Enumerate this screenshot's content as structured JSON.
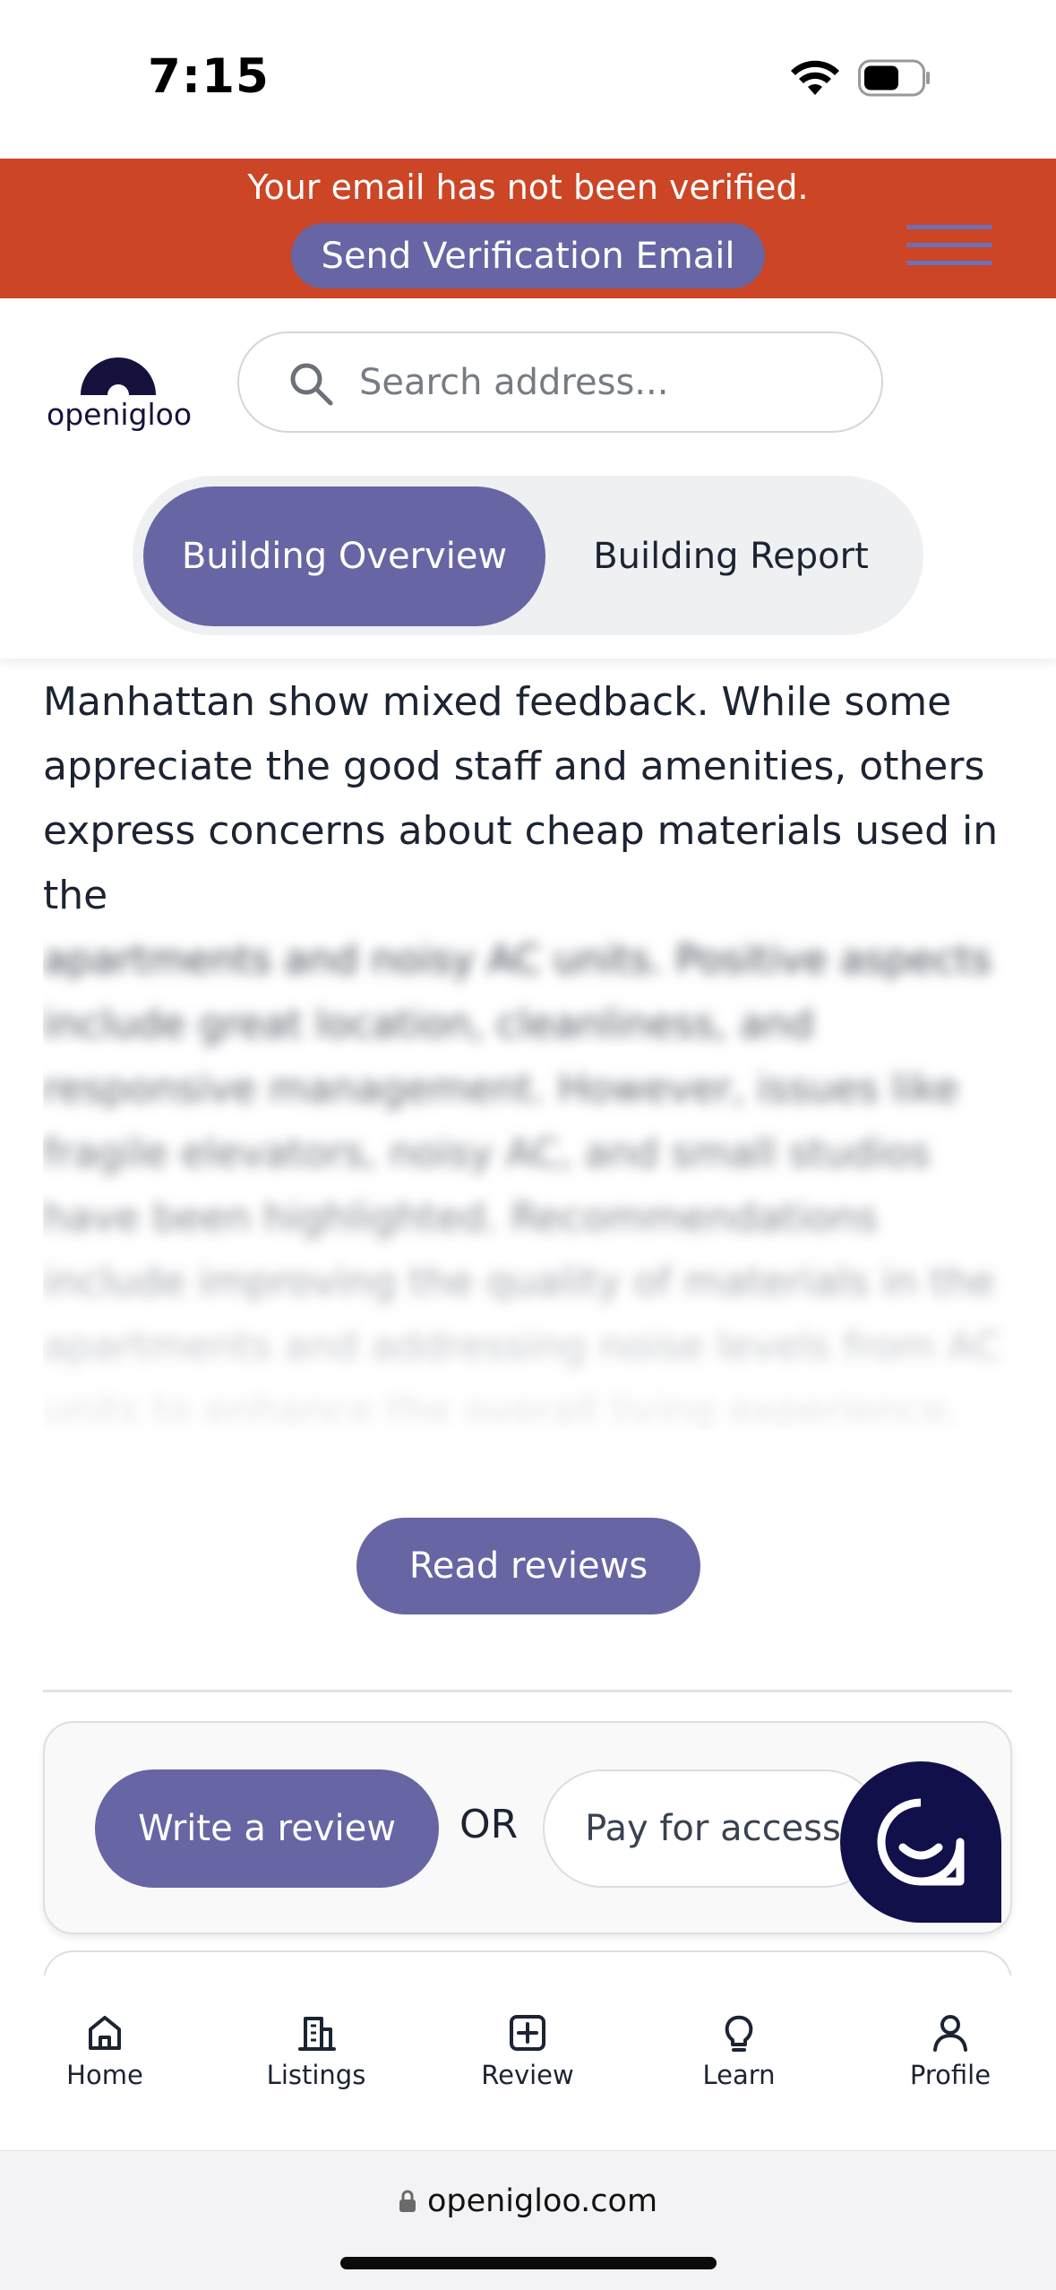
{
  "status_bar": {
    "time": "7:15"
  },
  "banner": {
    "message": "Your email has not been verified.",
    "button_label": "Send Verification Email",
    "bg_color": "#cc4525"
  },
  "header": {
    "logo_text": "openigloo",
    "search_placeholder": "Search address...",
    "tabs": [
      {
        "label": "Building Overview",
        "active": true
      },
      {
        "label": "Building Report",
        "active": false
      }
    ]
  },
  "content": {
    "summary_visible": "Manhattan show mixed feedback. While some appreciate the good staff and amenities, others express concerns about cheap materials used in the",
    "summary_blurred": "apartments and noisy AC units. Positive aspects include great location, cleanliness, and responsive management. However, issues like fragile elevators, noisy AC, and small studios have been highlighted. Recommendations include improving the quality of materials in the apartments and addressing noise levels from AC units to enhance the overall living experience.",
    "read_reviews_label": "Read reviews",
    "write_review_label": "Write a review",
    "or_label": "OR",
    "pay_access_label": "Pay for access"
  },
  "bottom_nav": {
    "items": [
      {
        "label": "Home",
        "icon": "home-icon"
      },
      {
        "label": "Listings",
        "icon": "building-icon"
      },
      {
        "label": "Review",
        "icon": "plus-square-icon"
      },
      {
        "label": "Learn",
        "icon": "lightbulb-icon"
      },
      {
        "label": "Profile",
        "icon": "user-icon"
      }
    ]
  },
  "browser": {
    "url": "openigloo.com"
  },
  "colors": {
    "accent": "#6865a4",
    "brand_dark": "#12104a",
    "banner": "#cc4525"
  }
}
